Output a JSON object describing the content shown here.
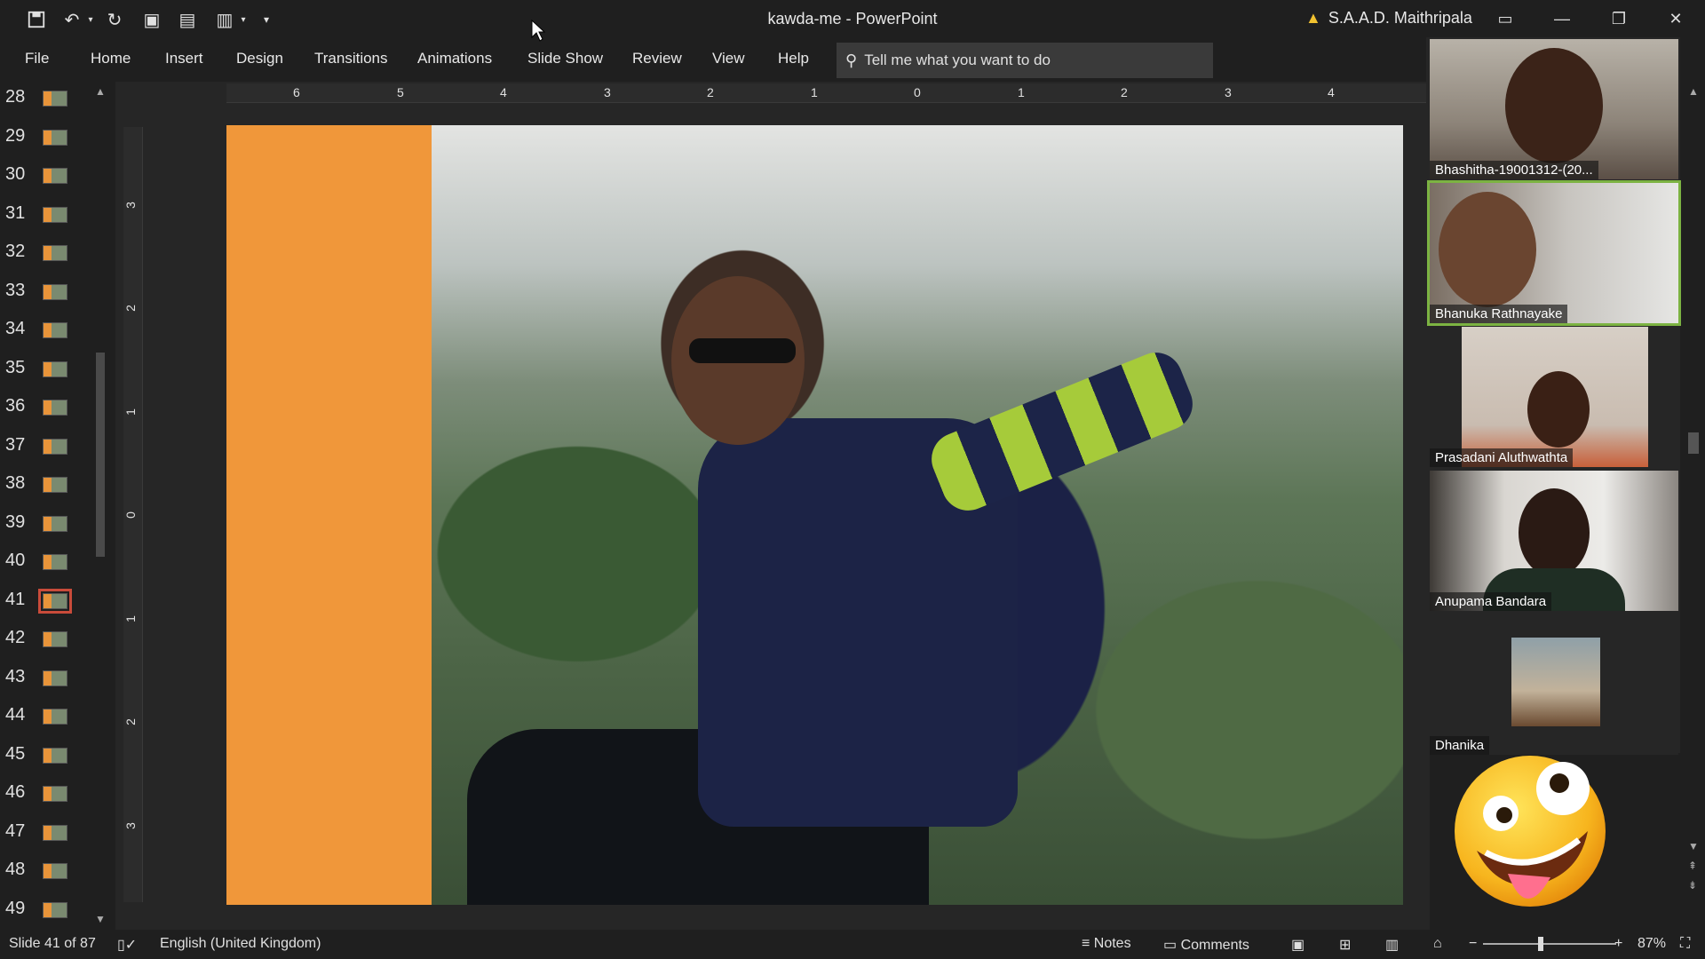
{
  "window": {
    "title": "kawda-me  -  PowerPoint",
    "user": "S.A.A.D. Maithripala"
  },
  "ribbon": {
    "tabs": [
      "File",
      "Home",
      "Insert",
      "Design",
      "Transitions",
      "Animations",
      "Slide Show",
      "Review",
      "View",
      "Help"
    ],
    "tell_me_placeholder": "Tell me what you want to do"
  },
  "thumbnails": {
    "numbers": [
      "28",
      "29",
      "30",
      "31",
      "32",
      "33",
      "34",
      "35",
      "36",
      "37",
      "38",
      "39",
      "40",
      "41",
      "42",
      "43",
      "44",
      "45",
      "46",
      "47",
      "48",
      "49"
    ],
    "selected": "41"
  },
  "rulers": {
    "horizontal": [
      "6",
      "5",
      "4",
      "3",
      "2",
      "1",
      "0",
      "1",
      "2",
      "3",
      "4"
    ],
    "vertical": [
      "3",
      "2",
      "1",
      "0",
      "1",
      "2",
      "3"
    ]
  },
  "participants": [
    {
      "name": "Bhashitha-19001312-(20..."
    },
    {
      "name": "Bhanuka Rathnayake"
    },
    {
      "name": "Prasadani Aluthwathta"
    },
    {
      "name": "Anupama Bandara"
    },
    {
      "name": "Dhanika"
    }
  ],
  "statusbar": {
    "slide_info": "Slide 41 of 87",
    "language": "English (United Kingdom)",
    "notes": "Notes",
    "comments": "Comments",
    "zoom": "87%"
  },
  "colors": {
    "slide_background": "#f0973a",
    "selected_thumb_outline": "#c94b3a",
    "active_speaker_outline": "#7cb342"
  }
}
